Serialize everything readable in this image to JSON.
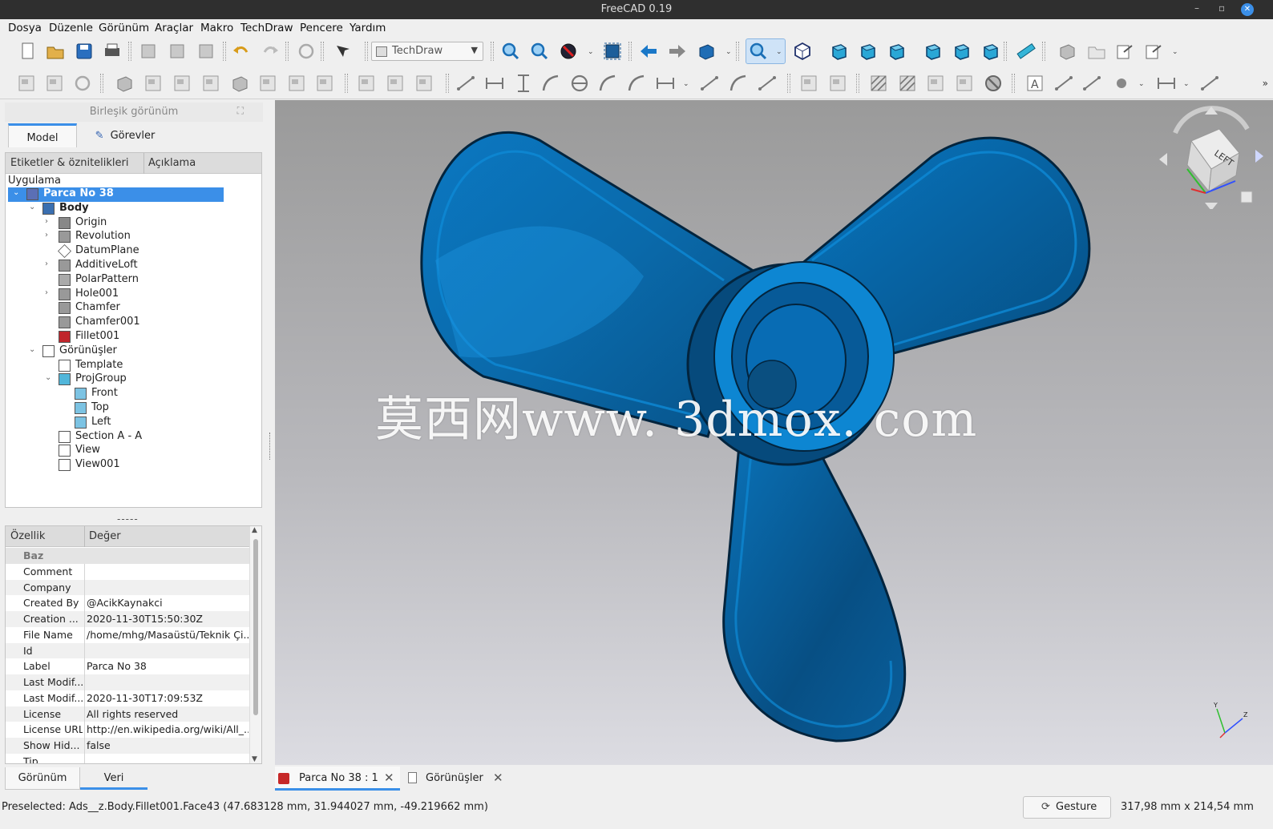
{
  "window": {
    "title": "FreeCAD 0.19",
    "controls": [
      "–",
      "▫",
      "✕"
    ]
  },
  "menu": [
    "Dosya",
    "Düzenle",
    "Görünüm",
    "Araçlar",
    "Makro",
    "TechDraw",
    "Pencere",
    "Yardım"
  ],
  "toolbar": {
    "workbench": "TechDraw",
    "overflow": "»"
  },
  "combo": {
    "title": "Birleşik görünüm",
    "tabs": {
      "model": "Model",
      "tasks": "Görevler"
    },
    "tree_headers": {
      "labels": "Etiketler & öznitelikleri",
      "description": "Açıklama"
    },
    "tree_root": "Uygulama",
    "tree": [
      {
        "label": "Parca No 38",
        "indent": 0,
        "expanded": true,
        "icon": "part-icon",
        "selected": true,
        "bold": true
      },
      {
        "label": "Body",
        "indent": 1,
        "expanded": true,
        "icon": "body-icon",
        "bold": true
      },
      {
        "label": "Origin",
        "indent": 2,
        "collapsed": true,
        "icon": "origin-icon"
      },
      {
        "label": "Revolution",
        "indent": 2,
        "collapsed": true,
        "icon": "revolution-icon"
      },
      {
        "label": "DatumPlane",
        "indent": 2,
        "icon": "datum-plane-icon"
      },
      {
        "label": "AdditiveLoft",
        "indent": 2,
        "collapsed": true,
        "icon": "loft-icon"
      },
      {
        "label": "PolarPattern",
        "indent": 2,
        "icon": "polar-pattern-icon"
      },
      {
        "label": "Hole001",
        "indent": 2,
        "collapsed": true,
        "icon": "hole-icon"
      },
      {
        "label": "Chamfer",
        "indent": 2,
        "icon": "chamfer-icon"
      },
      {
        "label": "Chamfer001",
        "indent": 2,
        "icon": "chamfer-icon"
      },
      {
        "label": "Fillet001",
        "indent": 2,
        "icon": "fillet-icon"
      },
      {
        "label": "Görünüşler",
        "indent": 1,
        "expanded": true,
        "icon": "page-icon"
      },
      {
        "label": "Template",
        "indent": 2,
        "icon": "template-icon"
      },
      {
        "label": "ProjGroup",
        "indent": 2,
        "expanded": true,
        "icon": "projgroup-icon"
      },
      {
        "label": "Front",
        "indent": 3,
        "icon": "proj-view-icon"
      },
      {
        "label": "Top",
        "indent": 3,
        "icon": "proj-view-icon"
      },
      {
        "label": "Left",
        "indent": 3,
        "icon": "proj-view-icon"
      },
      {
        "label": "Section A - A",
        "indent": 2,
        "icon": "section-view-icon"
      },
      {
        "label": "View",
        "indent": 2,
        "icon": "view-icon"
      },
      {
        "label": "View001",
        "indent": 2,
        "icon": "view-icon"
      }
    ],
    "splitter": "-----",
    "props_headers": {
      "name": "Özellik",
      "value": "Değer"
    },
    "props": [
      {
        "name": "Baz",
        "value": "",
        "group": true
      },
      {
        "name": "Comment",
        "value": ""
      },
      {
        "name": "Company",
        "value": ""
      },
      {
        "name": "Created By",
        "value": "@AcikKaynakci"
      },
      {
        "name": "Creation ...",
        "value": "2020-11-30T15:50:30Z"
      },
      {
        "name": "File Name",
        "value": "/home/mhg/Masaüstü/Teknik Çi..."
      },
      {
        "name": "Id",
        "value": ""
      },
      {
        "name": "Label",
        "value": "Parca No 38"
      },
      {
        "name": "Last Modif...",
        "value": ""
      },
      {
        "name": "Last Modif...",
        "value": "2020-11-30T17:09:53Z"
      },
      {
        "name": "License",
        "value": "All rights reserved"
      },
      {
        "name": "License URL",
        "value": "http://en.wikipedia.org/wiki/All_..."
      },
      {
        "name": "Show Hid...",
        "value": "false"
      },
      {
        "name": "Tip",
        "value": ""
      }
    ],
    "bottom_tabs": {
      "view": "Görünüm",
      "data": "Veri"
    }
  },
  "viewport": {
    "watermark": "莫西网www. 3dmox. com",
    "navcube_face": "LEFT",
    "model_color": "#0a6db0"
  },
  "doc_tabs": [
    {
      "label": "Parca No 38 : 1",
      "icon": "freecad-doc-icon",
      "active": true
    },
    {
      "label": "Görünüşler",
      "icon": "page-doc-icon",
      "active": false
    }
  ],
  "status": {
    "text": "Preselected: Ads__z.Body.Fillet001.Face43 (47.683128 mm, 31.944027 mm, -49.219662 mm)",
    "nav_style": "Gesture",
    "dimensions": "317,98 mm x 214,54 mm"
  },
  "colors": {
    "accent": "#3b8fe8",
    "selection": "#3b8fe8",
    "model_blue": "#0a6db0"
  }
}
